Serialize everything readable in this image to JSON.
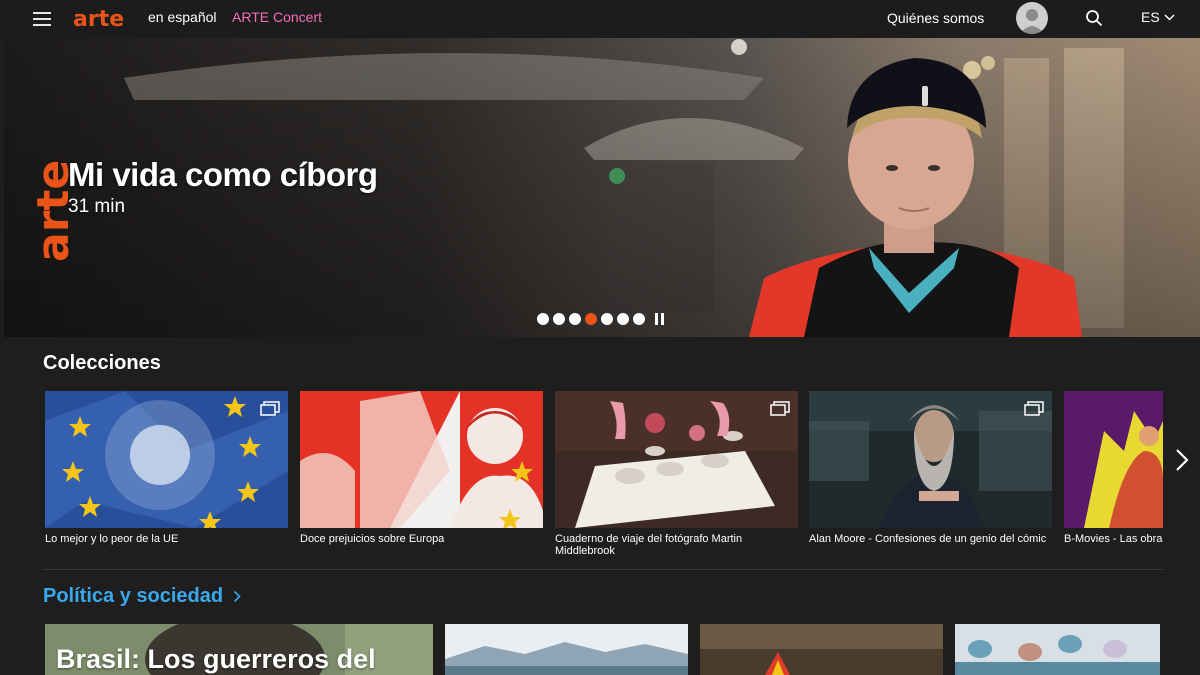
{
  "header": {
    "brand": "arte",
    "brand_sub": "en español",
    "concert_link": "ARTE Concert",
    "about_link": "Quiénes somos",
    "language": "ES"
  },
  "hero": {
    "logo_text": "arte",
    "title": "Mi vida como cíborg",
    "duration": "31 min",
    "slides_total": 7,
    "slide_active": 4
  },
  "collections": {
    "title": "Colecciones",
    "items": [
      {
        "label": "Lo mejor y lo peor de la UE"
      },
      {
        "label": "Doce prejuicios sobre Europa"
      },
      {
        "label": "Cuaderno de viaje del fotógrafo Martin Middlebrook"
      },
      {
        "label": "Alan Moore - Confesiones de un genio del cómic"
      },
      {
        "label": "B-Movies - Las obras maestras de la serie B"
      }
    ]
  },
  "politics": {
    "title": "Política y sociedad",
    "items": [
      {
        "title": "Brasil: Los guerreros del"
      },
      {
        "title": ""
      },
      {
        "title": ""
      },
      {
        "title": ""
      }
    ]
  },
  "colors": {
    "accent": "#ea5419",
    "concert": "#f26eb8",
    "section_link": "#3ba7ec",
    "background": "#1e1e1e"
  }
}
